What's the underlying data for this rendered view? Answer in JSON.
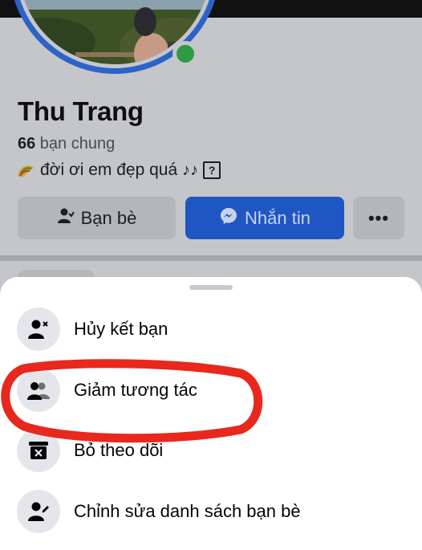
{
  "profile": {
    "name": "Thu Trang",
    "mutual_count": "66",
    "mutual_label": " bạn chung",
    "bio_text": "đời ơi em đẹp quá",
    "bio_box_char": "?"
  },
  "actions": {
    "friends_label": "Bạn bè",
    "message_label": "Nhắn tin",
    "more_label": "•••"
  },
  "sheet": {
    "items": [
      {
        "label": "Hủy kết bạn",
        "icon": "person-remove-icon"
      },
      {
        "label": "Giảm tương tác",
        "icon": "people-icon"
      },
      {
        "label": "Bỏ theo dõi",
        "icon": "unfollow-box-icon"
      },
      {
        "label": "Chỉnh sửa danh sách bạn bè",
        "icon": "person-edit-icon"
      }
    ]
  },
  "colors": {
    "accent": "#1877f2",
    "online": "#31a24c",
    "highlight_oval": "#e8281d"
  }
}
